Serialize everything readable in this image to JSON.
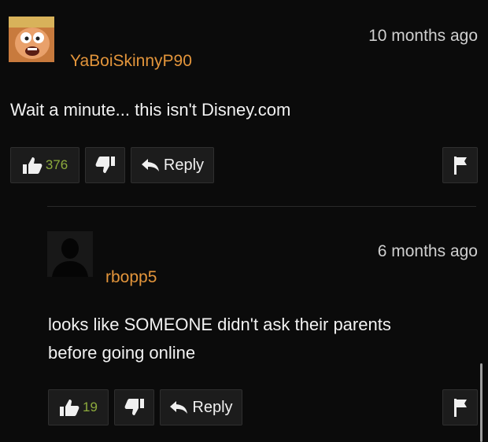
{
  "comments": [
    {
      "username": "YaBoiSkinnyP90",
      "time": "10 months ago",
      "text": "Wait a minute... this isn't Disney.com",
      "likes": "376",
      "reply_label": "Reply",
      "avatar_icon": "cartoon-face-avatar",
      "colors": {
        "username": "#e3953b",
        "like_count": "#8dab3c"
      }
    },
    {
      "username": "rbopp5",
      "time": "6 months ago",
      "text_line1": "looks like SOMEONE didn't ask their parents",
      "text_line2": "before going online",
      "likes": "19",
      "reply_label": "Reply",
      "avatar_icon": "default-user-silhouette-avatar"
    }
  ]
}
